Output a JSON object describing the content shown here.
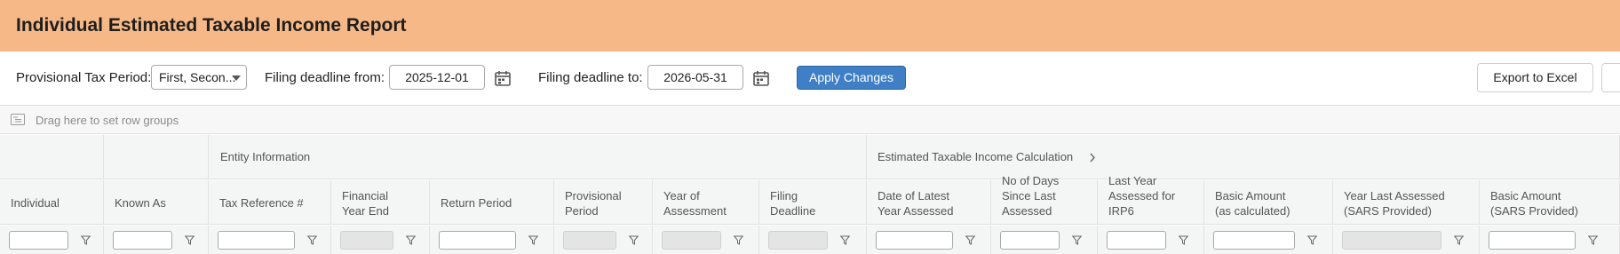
{
  "header": {
    "title": "Individual Estimated Taxable Income Report"
  },
  "toolbar": {
    "period_label": "Provisional Tax Period:",
    "period_value": "First, Secon...",
    "from_label": "Filing deadline from:",
    "from_value": "2025-12-01",
    "to_label": "Filing deadline to:",
    "to_value": "2026-05-31",
    "apply_label": "Apply Changes",
    "export_label": "Export to Excel"
  },
  "grid": {
    "group_panel_text": "Drag here to set row groups",
    "bands": {
      "entity": "Entity Information",
      "estimated": "Estimated Taxable Income Calculation"
    },
    "columns": [
      {
        "l1": "Individual",
        "l2": "",
        "l3": ""
      },
      {
        "l1": "Known As",
        "l2": "",
        "l3": ""
      },
      {
        "l1": "Tax Reference #",
        "l2": "",
        "l3": ""
      },
      {
        "l1": "Financial",
        "l2": "Year End",
        "l3": ""
      },
      {
        "l1": "Return Period",
        "l2": "",
        "l3": ""
      },
      {
        "l1": "Provisional",
        "l2": "Period",
        "l3": ""
      },
      {
        "l1": "Year of",
        "l2": "Assessment",
        "l3": ""
      },
      {
        "l1": "Filing",
        "l2": "Deadline",
        "l3": ""
      },
      {
        "l1": "Date of Latest",
        "l2": "Year Assessed",
        "l3": ""
      },
      {
        "l1": "No of Days",
        "l2": "Since Last",
        "l3": "Assessed"
      },
      {
        "l1": "Last Year",
        "l2": "Assessed for",
        "l3": "IRP6"
      },
      {
        "l1": "Basic Amount",
        "l2": "(as calculated)",
        "l3": ""
      },
      {
        "l1": "Year Last Assessed",
        "l2": "(SARS Provided)",
        "l3": ""
      },
      {
        "l1": "Basic Amount",
        "l2": "(SARS Provided)",
        "l3": ""
      }
    ]
  },
  "colors": {
    "title_bar": "#f6b886",
    "primary_button": "#3f7fc6",
    "grid_header": "#f4f5f5"
  },
  "icons": {
    "calendar": "calendar-icon",
    "filter": "filter-icon",
    "group": "group-panel-icon",
    "expand": "chevron-right-icon"
  }
}
